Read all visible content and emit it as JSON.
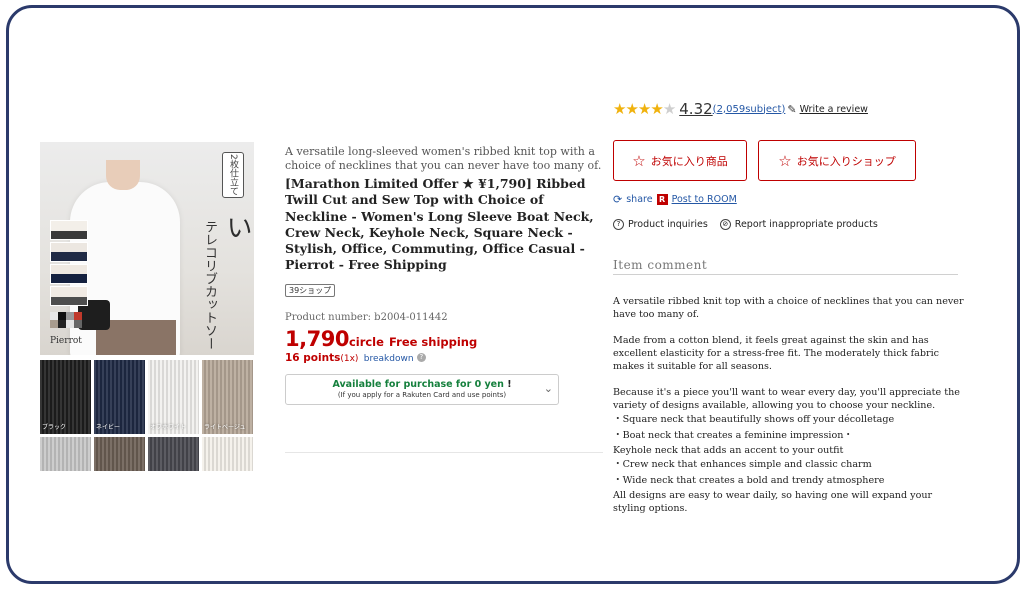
{
  "gallery": {
    "main_image": {
      "badge_text": "2枚仕立て",
      "headline_text": "で透けにくい",
      "sub_text": "テレコリブカットソー",
      "brand_text": "Pierrot",
      "swatch_colors": [
        "#e8e8e8",
        "#111111",
        "#9a9a9a",
        "#c0392b",
        "#a89c8e",
        "#222222",
        "#e4e4e4",
        "#666666"
      ]
    },
    "colors": [
      {
        "name": "ブラック",
        "hex": "#1e1e1e"
      },
      {
        "name": "ネイビー",
        "hex": "#1f2a45"
      },
      {
        "name": "オフホワイト",
        "hex": "#f2f1ee"
      },
      {
        "name": "ライトベージュ",
        "hex": "#b7a899"
      },
      {
        "name": "",
        "hex": "#c7c7c7"
      },
      {
        "name": "",
        "hex": "#6c5f55"
      },
      {
        "name": "",
        "hex": "#4a4a50"
      },
      {
        "name": "",
        "hex": "#f4f1ea"
      }
    ]
  },
  "product": {
    "tagline": "A versatile long-sleeved women's ribbed knit top with a choice of necklines that you can never have too many of.",
    "title": "[Marathon Limited Offer ★ ¥1,790] Ribbed Twill Cut and Sew Top with Choice of Neckline - Women's Long Sleeve Boat Neck, Crew Neck, Keyhole Neck, Square Neck - Stylish, Office, Commuting, Office Casual - Pierrot - Free Shipping",
    "shop_badge": "39ショップ",
    "product_number": "Product number: b2004-011442",
    "price": "1,790",
    "price_unit": "circle",
    "shipping": "Free shipping",
    "points": "16 points",
    "points_multiplier": "(1x)",
    "breakdown_label": "breakdown",
    "help_icon": "question-circle-icon",
    "card_offer": {
      "line1": "Available for purchase for 0 yen",
      "line1_suffix": "!",
      "line2": "(If you apply for a Rakuten Card and use points)",
      "chevron_icon": "chevron-down-icon"
    }
  },
  "review": {
    "stars_filled": 4,
    "stars_total": 5,
    "score": "4.32",
    "count_text": "(2,059subject)",
    "write_label": "Write a review",
    "star_color": "#f0b20e"
  },
  "actions": {
    "favorite_item_label": "お気に入り商品",
    "favorite_shop_label": "お気に入りショップ",
    "share_label": "share",
    "room_logo": "R",
    "post_room_label": "Post to ROOM",
    "inquiry_label": "Product inquiries",
    "report_label": "Report inappropriate products"
  },
  "item_comment": {
    "heading": "Item comment",
    "paragraphs": [
      "A versatile ribbed knit top with a choice of necklines that you can never have too many of.",
      "Made from a cotton blend, it feels great against the skin and has excellent elasticity for a stress-free fit. The moderately thick fabric makes it suitable for all seasons.",
      "Because it's a piece you'll want to wear every day, you'll appreciate the variety of designs available, allowing you to choose your neckline."
    ],
    "bullets": [
      "・Square neck that beautifully shows off your décolletage",
      "・Boat neck that creates a feminine impression・",
      "Keyhole neck that adds an accent to your outfit",
      "・Crew neck that enhances simple and classic charm",
      "・Wide neck that creates a bold and trendy atmosphere"
    ],
    "closing": "All designs are easy to wear daily, so having one will expand your styling options."
  },
  "colors": {
    "brand_red": "#bf0000",
    "link_blue": "#2457a5",
    "frame": "#2b3a6b",
    "offer_green": "#15803d"
  }
}
